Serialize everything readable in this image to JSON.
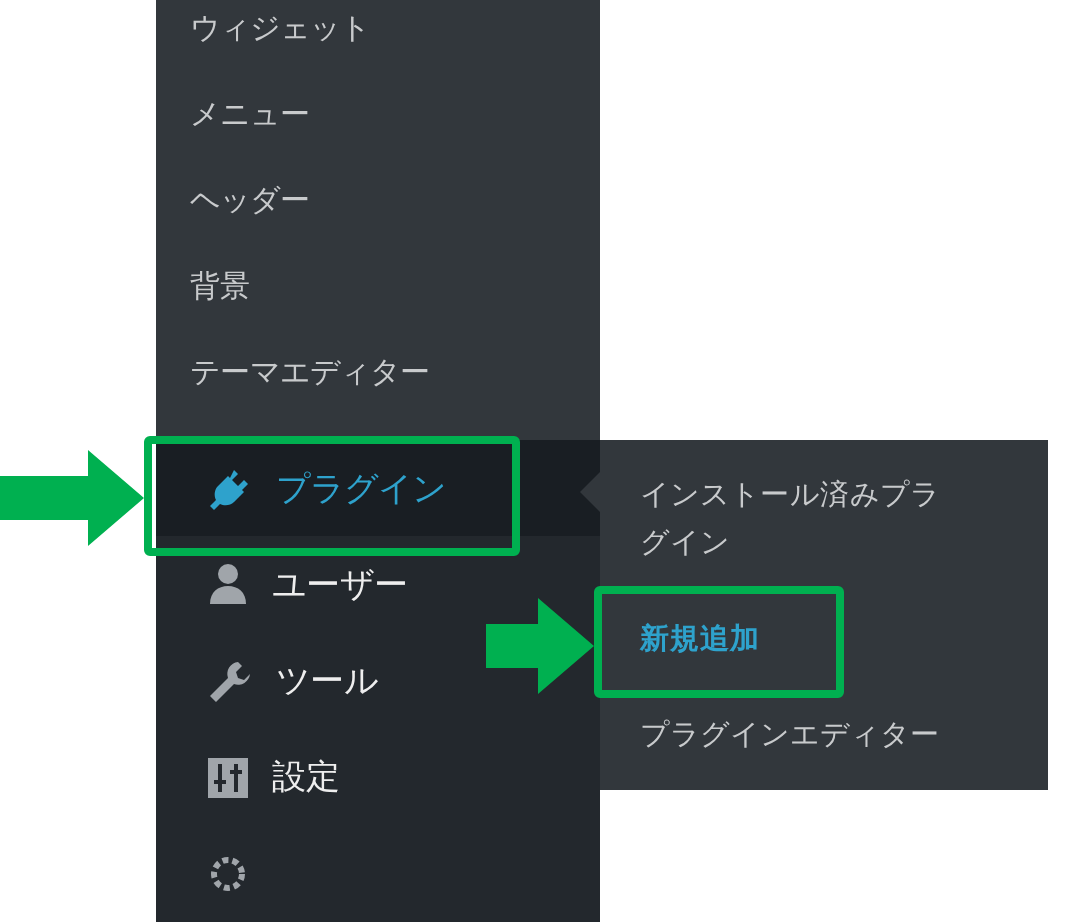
{
  "sidebar": {
    "submenu_items": [
      {
        "label": "ウィジェット"
      },
      {
        "label": "メニュー"
      },
      {
        "label": "ヘッダー"
      },
      {
        "label": "背景"
      },
      {
        "label": "テーマエディター"
      }
    ],
    "menu_items": [
      {
        "kind": "plugin",
        "label": "プラグイン",
        "selected": true
      },
      {
        "kind": "user",
        "label": "ユーザー",
        "selected": false
      },
      {
        "kind": "tool",
        "label": "ツール",
        "selected": false
      },
      {
        "kind": "settings",
        "label": "設定",
        "selected": false
      },
      {
        "kind": "gear"
      }
    ]
  },
  "flyout": {
    "items": [
      {
        "label": "インストール済みプラグイン",
        "selected": false
      },
      {
        "label": "新規追加",
        "selected": true
      },
      {
        "label": "プラグインエディター",
        "selected": false
      }
    ]
  }
}
